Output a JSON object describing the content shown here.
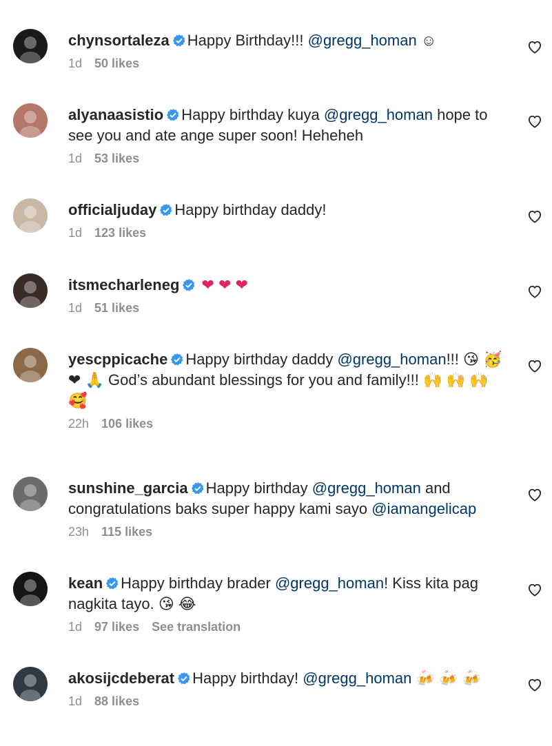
{
  "comments": [
    {
      "username": "chynsortaleza",
      "parts": [
        {
          "t": "Happy Birthday!!! "
        },
        {
          "t": "@gregg_homan",
          "mention": true
        },
        {
          "t": " ☺"
        }
      ],
      "time": "1d",
      "likes": "50 likes"
    },
    {
      "username": "alyanaasistio",
      "parts": [
        {
          "t": "Happy birthday kuya "
        },
        {
          "t": "@gregg_homan",
          "mention": true
        },
        {
          "t": " hope to see you and ate ange super soon! Heheheh"
        }
      ],
      "time": "1d",
      "likes": "53 likes"
    },
    {
      "username": "officialjuday",
      "parts": [
        {
          "t": "Happy birthday daddy!"
        }
      ],
      "time": "1d",
      "likes": "123 likes"
    },
    {
      "username": "itsmecharleneg",
      "parts": [
        {
          "t": " ❤ ❤ ❤",
          "red": true
        }
      ],
      "time": "1d",
      "likes": "51 likes"
    },
    {
      "username": "yescppicache",
      "parts": [
        {
          "t": "Happy birthday daddy "
        },
        {
          "t": "@gregg_homan",
          "mention": true
        },
        {
          "t": "!!! 😘 🥳 ❤ 🙏 God’s abundant blessings for you and family!!! 🙌 🙌 🙌 🥰"
        }
      ],
      "time": "22h",
      "likes": "106 likes"
    },
    {
      "username": "sunshine_garcia",
      "parts": [
        {
          "t": "Happy birthday "
        },
        {
          "t": "@gregg_homan",
          "mention": true
        },
        {
          "t": " and congratulations baks super happy kami sayo "
        },
        {
          "t": "@iamangelicap",
          "mention": true
        }
      ],
      "time": "23h",
      "likes": "115 likes"
    },
    {
      "username": "kean",
      "parts": [
        {
          "t": "Happy birthday brader "
        },
        {
          "t": "@gregg_homan",
          "mention": true
        },
        {
          "t": "! Kiss kita pag nagkita tayo. 😘 😂"
        }
      ],
      "time": "1d",
      "likes": "97 likes",
      "translate": "See translation"
    },
    {
      "username": "akosijcdeberat",
      "parts": [
        {
          "t": "Happy birthday! "
        },
        {
          "t": "@gregg_homan",
          "mention": true
        },
        {
          "t": " 🍻 🍻 🍻"
        }
      ],
      "time": "1d",
      "likes": "88 likes"
    }
  ]
}
